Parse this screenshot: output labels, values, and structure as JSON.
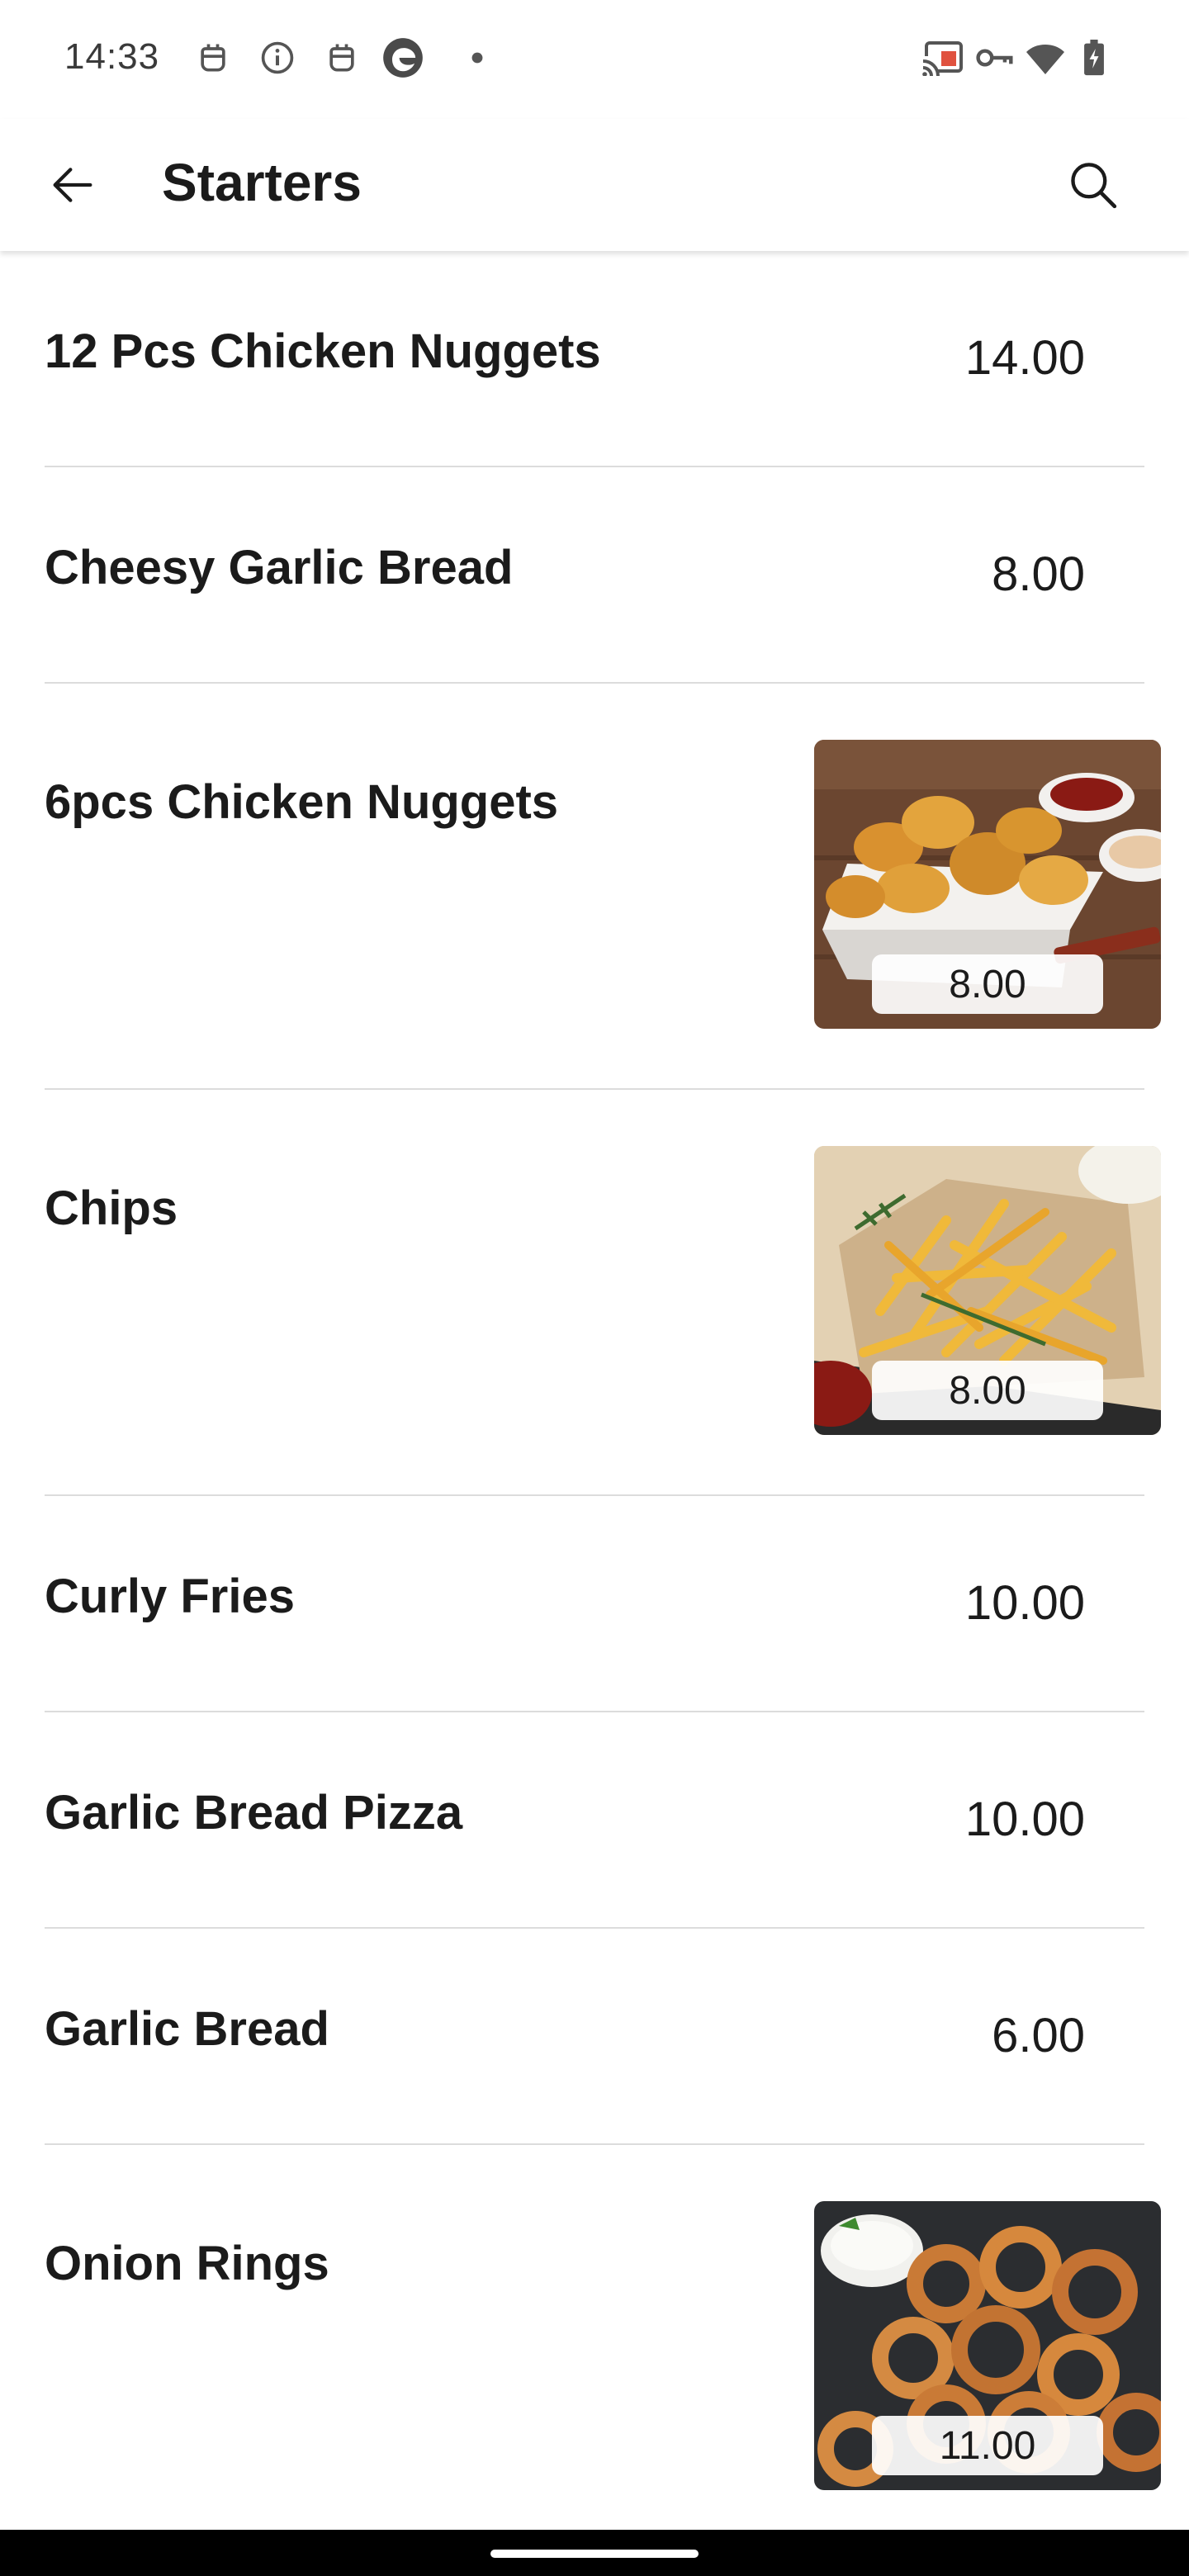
{
  "status_bar": {
    "time": "14:33",
    "left_icons": [
      "bot-icon",
      "info-icon",
      "bot-icon",
      "edge-browser-icon",
      "dot-icon"
    ],
    "right_icons": [
      "cast-icon",
      "vpn-key-icon",
      "wifi-icon",
      "battery-charging-icon"
    ]
  },
  "app_bar": {
    "title": "Starters",
    "back_icon": "arrow-left-icon",
    "search_icon": "search-icon"
  },
  "items": [
    {
      "name": "12 Pcs Chicken Nuggets",
      "price": "14.00",
      "has_image": false
    },
    {
      "name": "Cheesy Garlic Bread",
      "price": "8.00",
      "has_image": false
    },
    {
      "name": "6pcs Chicken Nuggets",
      "price": "8.00",
      "has_image": true,
      "image": "chicken-nuggets-photo"
    },
    {
      "name": "Chips",
      "price": "8.00",
      "has_image": true,
      "image": "chips-photo"
    },
    {
      "name": "Curly Fries",
      "price": "10.00",
      "has_image": false
    },
    {
      "name": "Garlic Bread Pizza",
      "price": "10.00",
      "has_image": false
    },
    {
      "name": "Garlic Bread",
      "price": "6.00",
      "has_image": false
    },
    {
      "name": "Onion Rings",
      "price": "11.00",
      "has_image": true,
      "image": "onion-rings-photo"
    }
  ],
  "colors": {
    "text": "#1b1b1b",
    "divider": "#dcdcdc",
    "background": "#ffffff",
    "nav_bar": "#000000"
  }
}
